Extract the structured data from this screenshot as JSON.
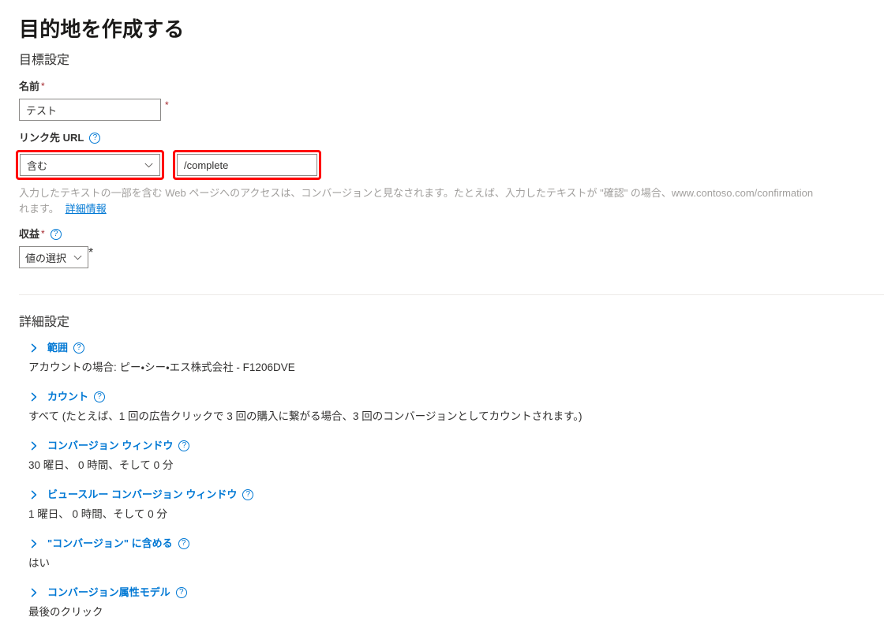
{
  "page": {
    "title": "目的地を作成する",
    "goal_section_heading": "目標設定",
    "advanced_section_heading": "詳細設定"
  },
  "fields": {
    "name": {
      "label": "名前",
      "required_marker": "*",
      "value": "テスト",
      "trailing_marker": "*"
    },
    "destination_url": {
      "label": "リンク先 URL",
      "help_icon": "help-circle-icon",
      "match_type_value": "含む",
      "chevron_icon": "chevron-down-icon",
      "url_value": "/complete",
      "helper_text": "入力したテキストの一部を含む Web ページへのアクセスは、コンバージョンと見なされます。たとえば、入力したテキストが \"確認\" の場合、www.contoso.com/confirmation",
      "helper_text_line2": "れます。",
      "helper_link": "詳細情報",
      "highlight_color": "#ff0000"
    },
    "revenue": {
      "label": "収益",
      "required_marker": "*",
      "help_icon": "help-circle-icon",
      "selected_value": "値の選択",
      "chevron_icon": "chevron-down-icon",
      "trailing_marker": "*"
    }
  },
  "advanced": {
    "items": [
      {
        "id": "scope",
        "chevron_icon": "chevron-right-icon",
        "title": "範囲",
        "help_icon": "help-circle-icon",
        "value": "アカウントの場合: ピー・シー・エス株式会社 - F1206DVE"
      },
      {
        "id": "count",
        "chevron_icon": "chevron-right-icon",
        "title": "カウント",
        "help_icon": "help-circle-icon",
        "value": "すべて (たとえば、1 回の広告クリックで 3 回の購入に繋がる場合、3 回のコンバージョンとしてカウントされます。)"
      },
      {
        "id": "conversion-window",
        "chevron_icon": "chevron-right-icon",
        "title": "コンバージョン ウィンドウ",
        "help_icon": "help-circle-icon",
        "value": "30 曜日、 0 時間、そして 0 分"
      },
      {
        "id": "view-through-conversion-window",
        "chevron_icon": "chevron-right-icon",
        "title": "ビュースルー コンバージョン ウィンドウ",
        "help_icon": "help-circle-icon",
        "value": "1 曜日、 0 時間、そして 0 分"
      },
      {
        "id": "include-in-conversions",
        "chevron_icon": "chevron-right-icon",
        "title": "\"コンバージョン\" に含める",
        "help_icon": "help-circle-icon",
        "value": "はい"
      },
      {
        "id": "conversion-attribution-model",
        "chevron_icon": "chevron-right-icon",
        "title": "コンバージョン属性モデル",
        "help_icon": "help-circle-icon",
        "value": "最後のクリック"
      }
    ]
  },
  "colors": {
    "accent": "#0078d4",
    "highlight": "#ff0000",
    "required": "#a4262c",
    "text": "#323130",
    "muted": "#a19f9d"
  }
}
